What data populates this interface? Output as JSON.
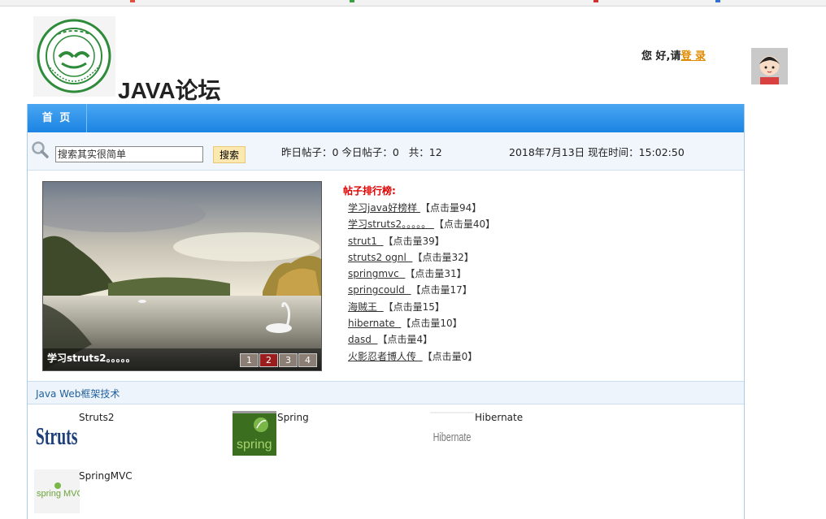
{
  "header": {
    "site_title": "JAVA论坛",
    "greeting": "您 好,请",
    "login_link": "登 录"
  },
  "nav": {
    "home_label": "首 页"
  },
  "search": {
    "placeholder": "搜索其实很简单",
    "button_label": "搜索",
    "stats": "昨日帖子：0 今日帖子：0   共：12",
    "datetime": "2018年7月13日 现在时间：15:02:50"
  },
  "slider": {
    "caption": "学习struts2。。。。。",
    "pages": [
      "1",
      "2",
      "3",
      "4"
    ],
    "active_page": "2"
  },
  "ranking": {
    "title": "帖子排行榜:",
    "items": [
      {
        "title": "学习java好榜样 ",
        "clicks": "【点击量94】"
      },
      {
        "title": "学习struts2。。。。。 ",
        "clicks": "【点击量40】"
      },
      {
        "title": "strut1  ",
        "clicks": "【点击量39】"
      },
      {
        "title": "struts2 ognl  ",
        "clicks": "【点击量32】"
      },
      {
        "title": "springmvc  ",
        "clicks": "【点击量31】"
      },
      {
        "title": "springcould  ",
        "clicks": "【点击量17】"
      },
      {
        "title": "海贼王  ",
        "clicks": "【点击量15】"
      },
      {
        "title": "hibernate  ",
        "clicks": "【点击量10】"
      },
      {
        "title": "dasd  ",
        "clicks": "【点击量4】"
      },
      {
        "title": "火影忍者博人传  ",
        "clicks": "【点击量0】"
      }
    ]
  },
  "section": {
    "title": "Java Web框架技术",
    "items": [
      {
        "name": "Struts2",
        "logo_text": "Struts"
      },
      {
        "name": "Spring",
        "logo_text": "spring"
      },
      {
        "name": "Hibernate",
        "logo_text": "Hibernate"
      },
      {
        "name": "SpringMVC",
        "logo_text": "spring MVC"
      }
    ]
  }
}
